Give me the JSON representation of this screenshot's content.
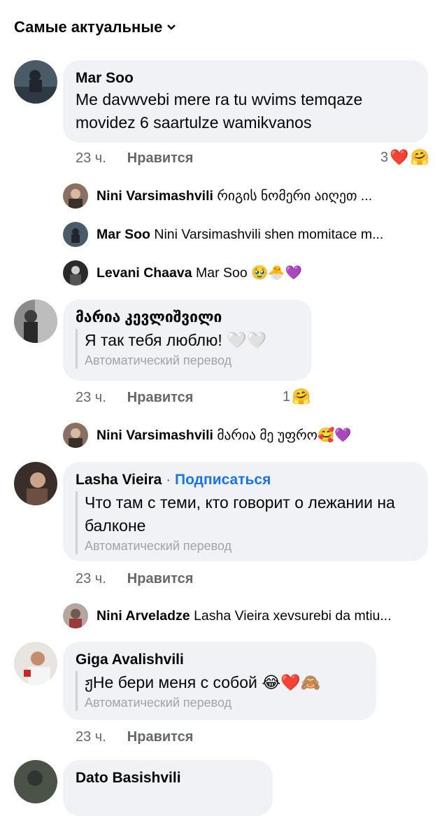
{
  "sort": {
    "label": "Самые актуальные"
  },
  "comments": [
    {
      "author": "Mar Soo",
      "text": "Me davwvebi mere ra tu wvims temqaze movidez 6 saartulze wamikvanos",
      "time": "23 ч.",
      "like": "Нравится",
      "reaction_count": "3"
    },
    {
      "author": "მარია კევლიშვილი",
      "text": "Я так тебя люблю! 🤍🤍",
      "auto_translation": "Автоматический перевод",
      "time": "23 ч.",
      "like": "Нравится",
      "reaction_count": "1"
    },
    {
      "author": "Lasha Vieira",
      "follow": "Подписаться",
      "text": "Что там с теми, кто говорит о лежании на балконе",
      "auto_translation": "Автоматический перевод",
      "time": "23 ч.",
      "like": "Нравится"
    },
    {
      "author": "Giga Avalishvili",
      "text": "ჟНе бери меня с собой 😂❤️🙈",
      "auto_translation": "Автоматический перевод",
      "time": "23 ч.",
      "like": "Нравится"
    },
    {
      "author": "Dato Basishvili"
    }
  ],
  "replies": [
    {
      "author": "Nini Varsimashvili",
      "text": "რიგის ნომერი აიღეთ ..."
    },
    {
      "author": "Mar Soo",
      "text": "Nini Varsimashvili shen momitace m..."
    },
    {
      "author": "Levani Chaava",
      "text": "Mar Soo 🥹🐣💜"
    },
    {
      "author": "Nini Varsimashvili",
      "text": "მარია მე უფრო🥰💜"
    },
    {
      "author": "Nini Arveladze",
      "text": "Lasha Vieira xevsurebi da mtiu..."
    }
  ],
  "colors": {
    "bubble": "#f0f2f5",
    "meta": "#65676b",
    "link": "#1b74e4"
  }
}
